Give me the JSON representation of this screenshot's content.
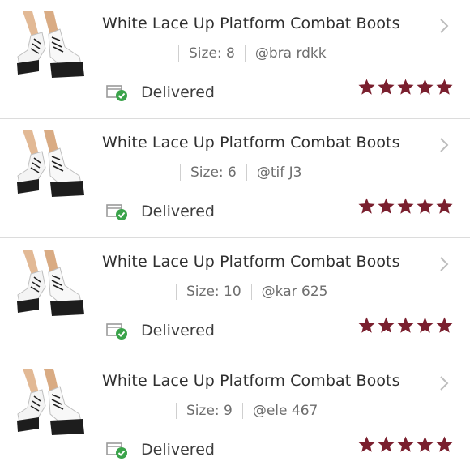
{
  "colors": {
    "star": "#7a1f2e",
    "check": "#3aa34a",
    "divider": "#dcdcdc"
  },
  "orders": [
    {
      "title": "White Lace Up Platform Combat Boots",
      "size": "Size: 8",
      "user": "@bra   rdkk",
      "status": "Delivered",
      "rating": 5
    },
    {
      "title": "White Lace Up Platform Combat Boots",
      "size": "Size: 6",
      "user": "@tif  J3",
      "status": "Delivered",
      "rating": 5
    },
    {
      "title": "White Lace Up Platform Combat Boots",
      "size": "Size: 10",
      "user": "@kar     625",
      "status": "Delivered",
      "rating": 5
    },
    {
      "title": "White Lace Up Platform Combat Boots",
      "size": "Size: 9",
      "user": "@ele    467",
      "status": "Delivered",
      "rating": 5
    }
  ]
}
